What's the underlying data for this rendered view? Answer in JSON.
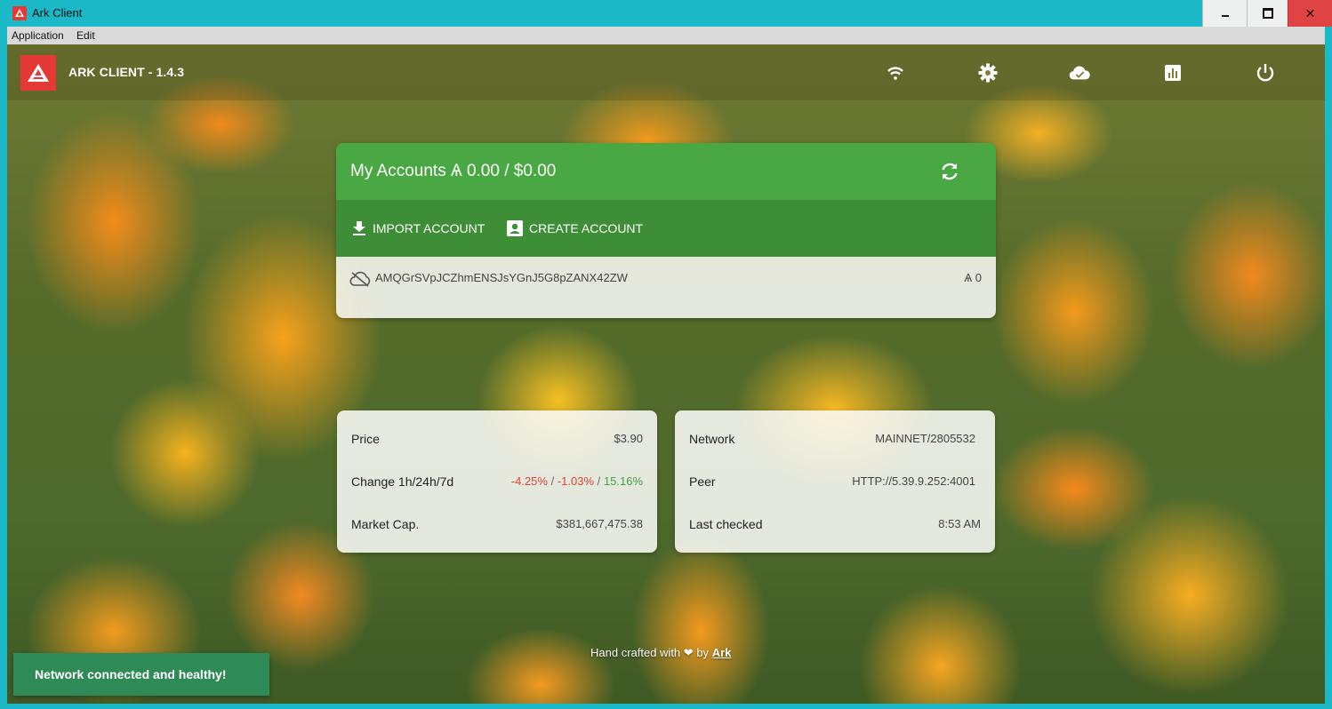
{
  "window": {
    "title": "Ark Client"
  },
  "menu": {
    "items": [
      "Application",
      "Edit"
    ]
  },
  "topbar": {
    "title": "ARK CLIENT - 1.4.3",
    "icons": [
      "wifi-icon",
      "settings-gear-icon",
      "cloud-done-icon",
      "chart-icon",
      "power-icon"
    ]
  },
  "accounts": {
    "title": "My Accounts Ѧ 0.00 / $0.00",
    "import_label": "IMPORT ACCOUNT",
    "create_label": "CREATE ACCOUNT",
    "rows": [
      {
        "address": "AMQGrSVpJCZhmENSJsYGnJ5G8pZANX42ZW",
        "balance": "Ѧ 0"
      }
    ]
  },
  "market": {
    "price_label": "Price",
    "price_value": "$3.90",
    "change_label": "Change 1h/24h/7d",
    "change_1h": "-4.25%",
    "change_24h": "-1.03%",
    "change_7d": "15.16%",
    "separator": "/",
    "cap_label": "Market Cap.",
    "cap_value": "$381,667,475.38"
  },
  "network": {
    "network_label": "Network",
    "network_value": "MAINNET/2805532",
    "peer_label": "Peer",
    "peer_value": "HTTP://5.39.9.252:4001",
    "checked_label": "Last checked",
    "checked_value": "8:53 AM"
  },
  "footer": {
    "prefix": "Hand crafted with",
    "by": "by",
    "link": "Ark"
  },
  "toast": {
    "message": "Network connected and healthy!"
  },
  "colors": {
    "window_frame": "#1bb8c8",
    "brand_red": "#e53935",
    "accounts_header": "#49a843",
    "accounts_actions": "#3e8e38",
    "toast": "#2e8b57",
    "negative": "#e0453a",
    "positive": "#43a047"
  }
}
